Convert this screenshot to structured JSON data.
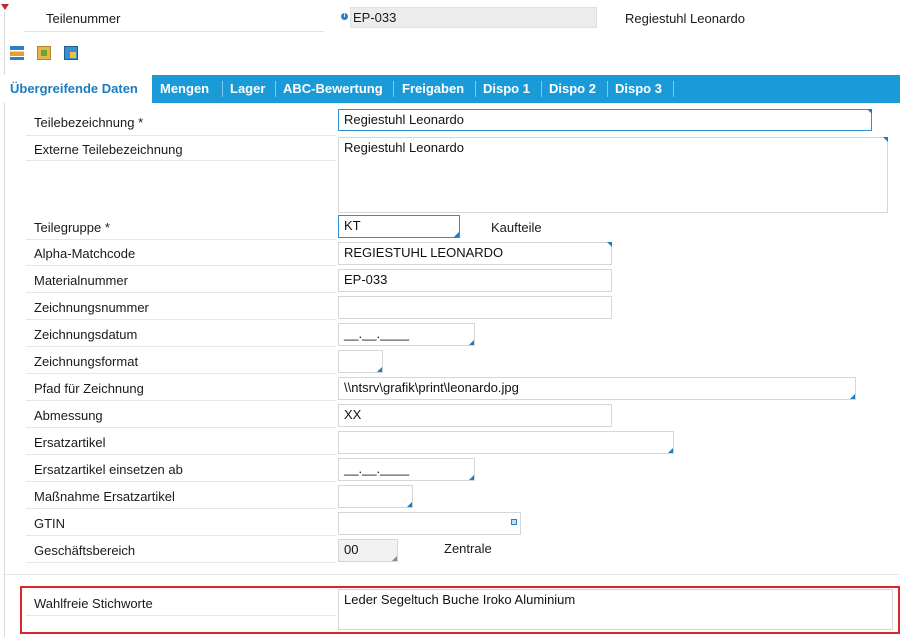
{
  "header": {
    "part_number_label": "Teilenummer",
    "part_number_value": "EP-033",
    "part_name": "Regiestuhl Leonardo",
    "info_icon": "i"
  },
  "toolbar": {
    "icons": [
      "grid-edit-icon",
      "document-search-icon",
      "save-icon"
    ]
  },
  "tabs": [
    {
      "label": "Übergreifende Daten",
      "active": true
    },
    {
      "label": "Mengen"
    },
    {
      "label": "Lager"
    },
    {
      "label": "ABC-Bewertung"
    },
    {
      "label": "Freigaben"
    },
    {
      "label": "Dispo 1"
    },
    {
      "label": "Dispo 2"
    },
    {
      "label": "Dispo 3"
    }
  ],
  "form": {
    "teilebezeichnung": {
      "label": "Teilebezeichnung *",
      "value": "Regiestuhl Leonardo"
    },
    "externe_teilebezeichnung": {
      "label": "Externe Teilebezeichnung",
      "value": "Regiestuhl Leonardo"
    },
    "teilegruppe": {
      "label": "Teilegruppe *",
      "value": "KT",
      "description": "Kaufteile"
    },
    "alpha_matchcode": {
      "label": "Alpha-Matchcode",
      "value": "REGIESTUHL LEONARDO"
    },
    "materialnummer": {
      "label": "Materialnummer",
      "value": "EP-033"
    },
    "zeichnungsnummer": {
      "label": "Zeichnungsnummer",
      "value": ""
    },
    "zeichnungsdatum": {
      "label": "Zeichnungsdatum",
      "value": "__.__.____"
    },
    "zeichnungsformat": {
      "label": "Zeichnungsformat",
      "value": ""
    },
    "pfad_fuer_zeichnung": {
      "label": "Pfad für Zeichnung",
      "value": "\\\\ntsrv\\grafik\\print\\leonardo.jpg"
    },
    "abmessung": {
      "label": "Abmessung",
      "value": "XX"
    },
    "ersatzartikel": {
      "label": "Ersatzartikel",
      "value": ""
    },
    "ersatzartikel_einsetzen_ab": {
      "label": "Ersatzartikel einsetzen ab",
      "value": "__.__.____"
    },
    "massnahme_ersatzartikel": {
      "label": "Maßnahme Ersatzartikel",
      "value": ""
    },
    "gtin": {
      "label": "GTIN",
      "value": ""
    },
    "geschaeftsbereich": {
      "label": "Geschäftsbereich",
      "value": "00",
      "description": "Zentrale"
    },
    "wahlfreie_stichworte": {
      "label": "Wahlfreie Stichworte",
      "value": "Leder Segeltuch Buche Iroko Aluminium"
    }
  },
  "colors": {
    "accent": "#1a9bd7",
    "highlight": "#d6262f",
    "marker": "#c0282d"
  }
}
